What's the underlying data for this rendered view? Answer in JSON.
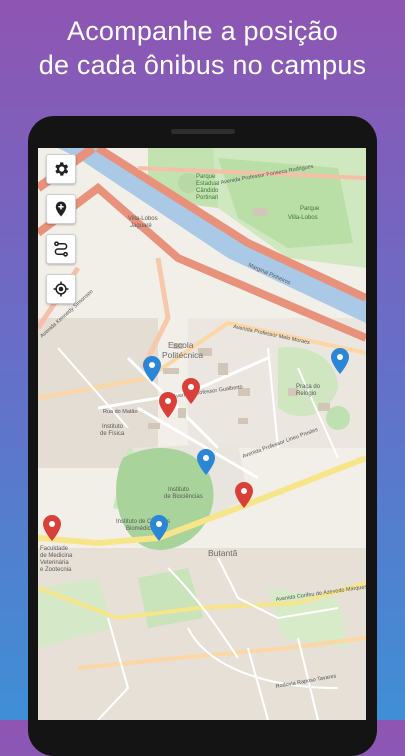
{
  "headline": {
    "line1": "Acompanhe a posição",
    "line2": "de cada ônibus no campus"
  },
  "map": {
    "labels": {
      "parque_estadual": [
        "Parque",
        "Estadual",
        "Cândido",
        "Portinari"
      ],
      "parque_villa_lobos": [
        "Parque",
        "Villa-Lobos"
      ],
      "villa_lobos_jaguare": [
        "Villa-Lobos",
        "Jaguaré"
      ],
      "escola_politecnica": [
        "Escola",
        "Politécnica"
      ],
      "butanta": "Butantã",
      "av_fonseca_rodrigues": "Avenida Professor Fonseca Rodrigues",
      "marginal_pinheiros": "Marginal Pinheiros",
      "av_melo_moraes": "Avenida Professor Melo Moraes",
      "rua_do_matao": "Rua do Matão",
      "av_lineu_prestes": "Avenida Professor Lineu Prestes",
      "praca_relogio": [
        "Praça do",
        "Relógio"
      ],
      "av_corifeu": "Avenida Corifeu de Azevedo Marques",
      "rod_raposo_tavares": "Rodovia Raposo Tavares",
      "av_gualberto": "Avenida Professor Gualberto",
      "instituto_fisica": [
        "Instituto",
        "de Física"
      ],
      "instituto_biociencias": [
        "Instituto",
        "de Biociências"
      ],
      "instituto_ciencias_biomedicas": [
        "Instituto de Ciências",
        "Biomédicas"
      ],
      "faculdade_medicina": [
        "Faculdade",
        "de Medicina",
        "Veterinária",
        "e Zootecnia"
      ],
      "av_kennedy": "Avenida Kennedy Simonsen"
    }
  },
  "toolbar": {
    "buttons": [
      {
        "icon": "gear-icon"
      },
      {
        "icon": "add-location-icon"
      },
      {
        "icon": "route-icon"
      },
      {
        "icon": "my-location-icon"
      }
    ]
  },
  "colors": {
    "bus_marker": "#2b86d6",
    "stop_marker": "#d9403a",
    "gradient_top": "#8f55b2",
    "gradient_bottom": "#3f8fd6"
  }
}
